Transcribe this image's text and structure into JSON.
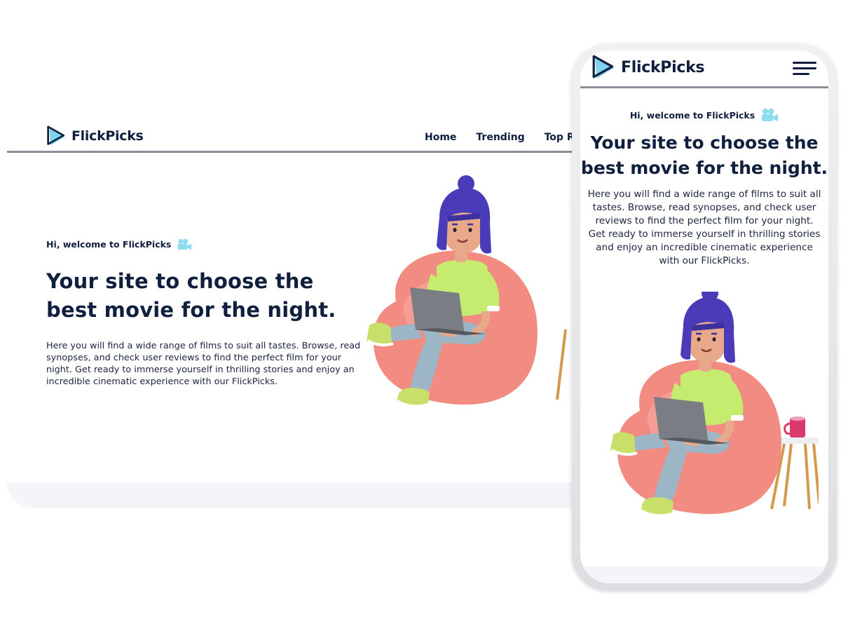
{
  "brand": {
    "name": "FlickPicks",
    "accent": "#7fd3ef",
    "text_color": "#0f1f3d"
  },
  "desktop": {
    "nav": [
      {
        "label": "Home"
      },
      {
        "label": "Trending"
      },
      {
        "label": "Top Rat"
      }
    ],
    "hero": {
      "welcome": "Hi, welcome to FlickPicks",
      "welcome_icon": "movie-camera-icon",
      "title_line1": "Your site to choose the",
      "title_line2": "best movie for the night.",
      "description": "Here you will find a wide range of films to suit all tastes. Browse, read synopses, and check user reviews to find the perfect film for your night. Get ready to immerse yourself in thrilling stories and enjoy an incredible cinematic experience with our FlickPicks."
    }
  },
  "mobile": {
    "menu_icon": "hamburger-menu-icon",
    "hero": {
      "welcome": "Hi, welcome to FlickPicks",
      "welcome_icon": "movie-camera-icon",
      "title_line1": "Your site to choose the",
      "title_line2": "best movie for the night.",
      "description": "Here you will find a wide range of films to suit all tastes. Browse, read synopses, and check user reviews to find the perfect film for your night. Get ready to immerse yourself in thrilling stories and enjoy an incredible cinematic experience with our FlickPicks."
    }
  }
}
